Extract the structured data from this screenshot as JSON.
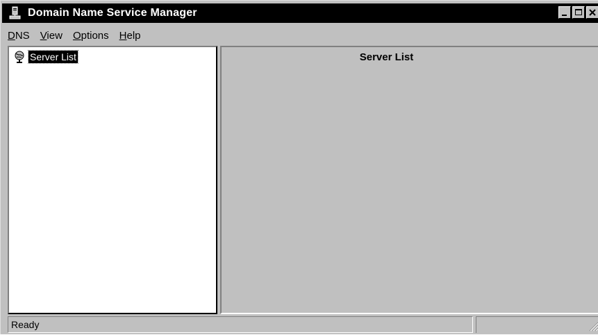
{
  "window": {
    "title": "Domain Name Service Manager",
    "title_icon": "server-tower-icon"
  },
  "title_buttons": [
    {
      "name": "minimize-button",
      "icon": "minimize-icon"
    },
    {
      "name": "maximize-button",
      "icon": "maximize-icon"
    },
    {
      "name": "close-button",
      "icon": "close-icon"
    }
  ],
  "menu": {
    "items": [
      {
        "label": "DNS",
        "mnemonic": "D"
      },
      {
        "label": "View",
        "mnemonic": "V"
      },
      {
        "label": "Options",
        "mnemonic": "O"
      },
      {
        "label": "Help",
        "mnemonic": "H"
      }
    ]
  },
  "tree": {
    "root": {
      "label": "Server List",
      "icon": "globe-icon",
      "selected": true
    }
  },
  "detail": {
    "title": "Server List"
  },
  "status": {
    "text": "Ready"
  },
  "colors": {
    "face": "#c0c0c0",
    "titlebar": "#000000",
    "selection": "#000000"
  }
}
